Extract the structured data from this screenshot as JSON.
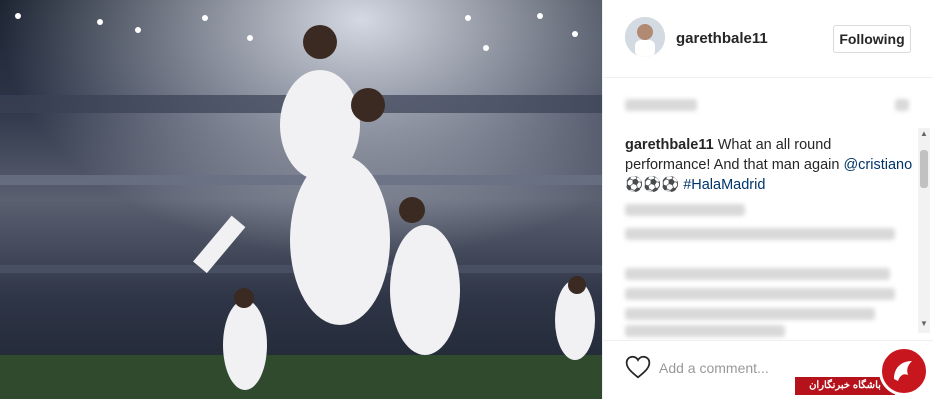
{
  "post": {
    "username": "garethbale11",
    "follow_label": "Following",
    "caption": {
      "username": "garethbale11",
      "text": " What an all round performance! And that man again ",
      "mention": "@cristiano",
      "emoji": " ⚽⚽⚽ ",
      "hashtag": "#HalaMadrid"
    },
    "comment_placeholder": "Add a comment...",
    "watermark_text": "باشگاه خبرنگاران"
  },
  "icons": {
    "heart": "heart-icon",
    "scroll_up": "scroll-up-arrow",
    "scroll_down": "scroll-down-arrow"
  },
  "colors": {
    "link": "#003569",
    "text": "#262626",
    "watermark": "#c8161f"
  }
}
